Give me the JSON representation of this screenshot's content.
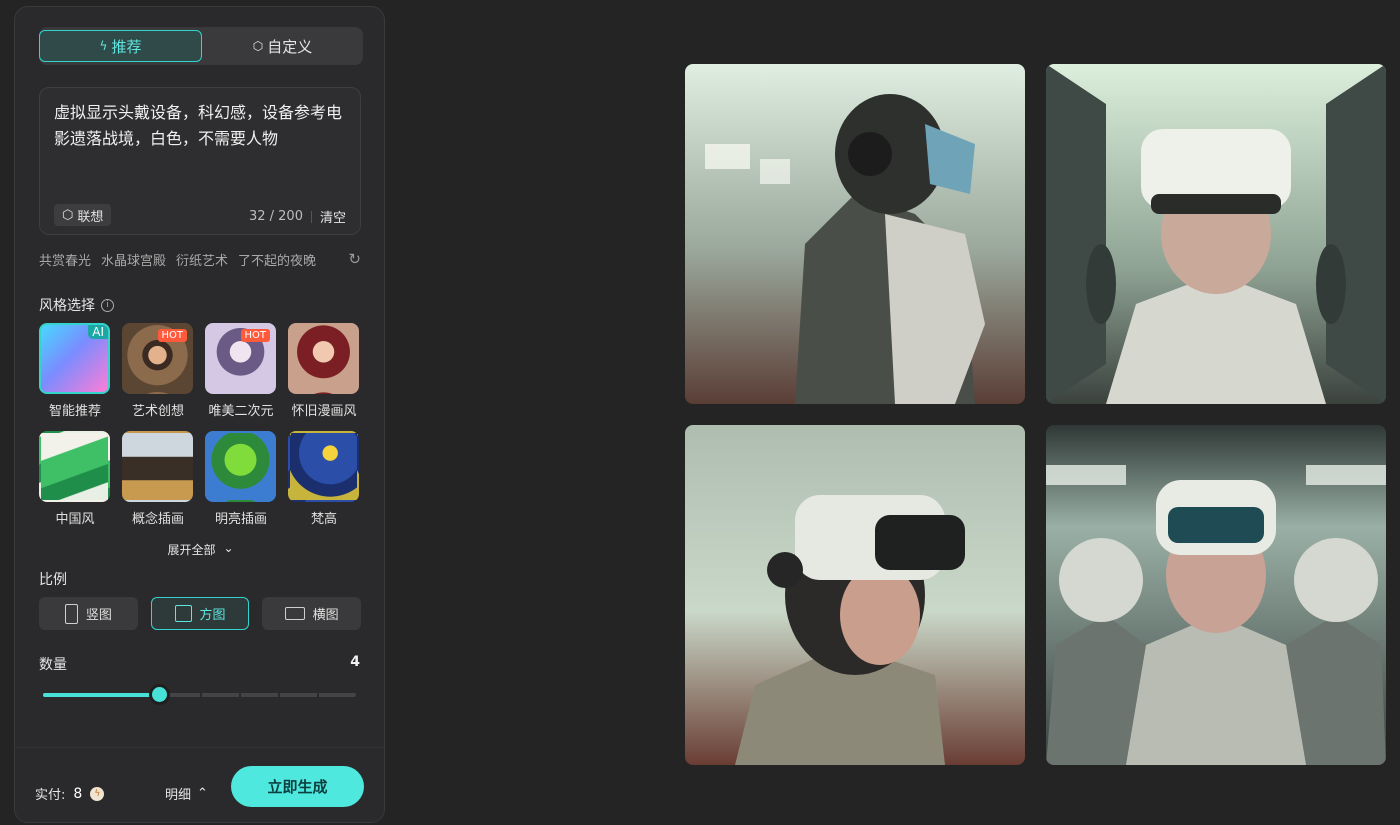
{
  "tabs": [
    {
      "label": "推荐",
      "icon": "bolt-icon",
      "active": true
    },
    {
      "label": "自定义",
      "icon": "cube-icon",
      "active": false
    }
  ],
  "prompt": {
    "text": "虚拟显示头戴设备，科幻感，设备参考电影遗落战境，白色，不需要人物",
    "assoc_label": "联想",
    "count": "32",
    "max": "200",
    "clear_label": "清空"
  },
  "suggestions": [
    "共赏春光",
    "水晶球宫殿",
    "衍纸艺术",
    "了不起的夜晚"
  ],
  "style_section": {
    "title": "风格选择",
    "items": [
      {
        "label": "智能推荐",
        "badge": "AI",
        "active": true
      },
      {
        "label": "艺术创想",
        "badge": "HOT"
      },
      {
        "label": "唯美二次元",
        "badge": "HOT"
      },
      {
        "label": "怀旧漫画风",
        "badge": ""
      },
      {
        "label": "中国风",
        "badge": ""
      },
      {
        "label": "概念插画",
        "badge": ""
      },
      {
        "label": "明亮插画",
        "badge": ""
      },
      {
        "label": "梵高",
        "badge": ""
      }
    ],
    "expand_label": "展开全部"
  },
  "ratio_section": {
    "title": "比例",
    "options": [
      {
        "label": "竖图",
        "active": false
      },
      {
        "label": "方图",
        "active": true
      },
      {
        "label": "横图",
        "active": false
      }
    ]
  },
  "quantity_section": {
    "title": "数量",
    "value": "4",
    "slider_fraction": 0.37
  },
  "footer": {
    "pay_label": "实付:",
    "pay_amount": "8",
    "detail_label": "明细",
    "generate_label": "立即生成"
  },
  "colors": {
    "accent": "#48e1d8",
    "panel": "#2a2a2c",
    "background": "#242424"
  }
}
